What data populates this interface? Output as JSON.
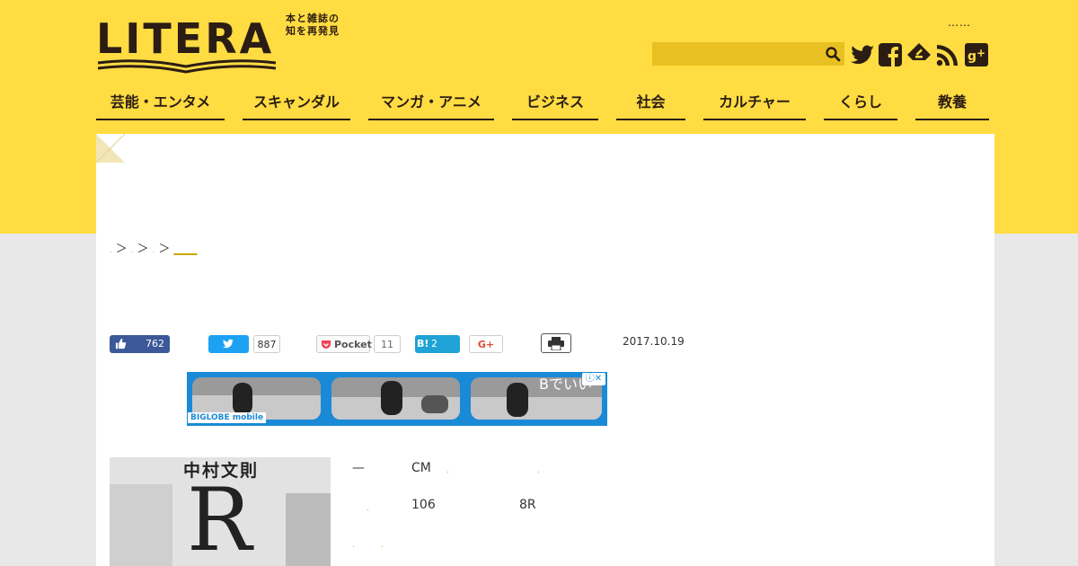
{
  "brand": {
    "logo": "LITERA",
    "tagline_line1": "本と雑誌の",
    "tagline_line2": "知を再発見"
  },
  "header": {
    "dots": "……",
    "search_placeholder": ""
  },
  "social_icons": [
    "twitter-icon",
    "facebook-icon",
    "feedly-icon",
    "rss-icon",
    "google-plus-icon"
  ],
  "nav": [
    {
      "label": "芸能・エンタメ"
    },
    {
      "label": "スキャンダル"
    },
    {
      "label": "マンガ・アニメ"
    },
    {
      "label": "ビジネス"
    },
    {
      "label": "社会"
    },
    {
      "label": "カルチャー"
    },
    {
      "label": "くらし"
    },
    {
      "label": "教養"
    }
  ],
  "breadcrumb": {
    "sep1": "＞",
    "sep2": "＞",
    "sep3": "＞",
    "current": "____"
  },
  "share": {
    "fb_count": "762",
    "tw_count": "887",
    "pocket_label": "Pocket",
    "pocket_count": "11",
    "hatena_label": "B!",
    "hatena_count": "2",
    "gplus_label": "G+"
  },
  "article": {
    "date": "2017.10.19",
    "dash": "—",
    "cm": "CM",
    "num_106": "106",
    "num_8r": "8R"
  },
  "ad": {
    "logo_text": "BIGLOBE mobile",
    "text": "Bでいい"
  },
  "cover": {
    "author": "中村文則",
    "title": "R"
  },
  "colors": {
    "yellow": "#ffdc42",
    "dark": "#2b1d13",
    "gold": "#c8a400",
    "facebook": "#3b5998",
    "twitter": "#1da1f2",
    "hatena": "#1fa3d6"
  }
}
